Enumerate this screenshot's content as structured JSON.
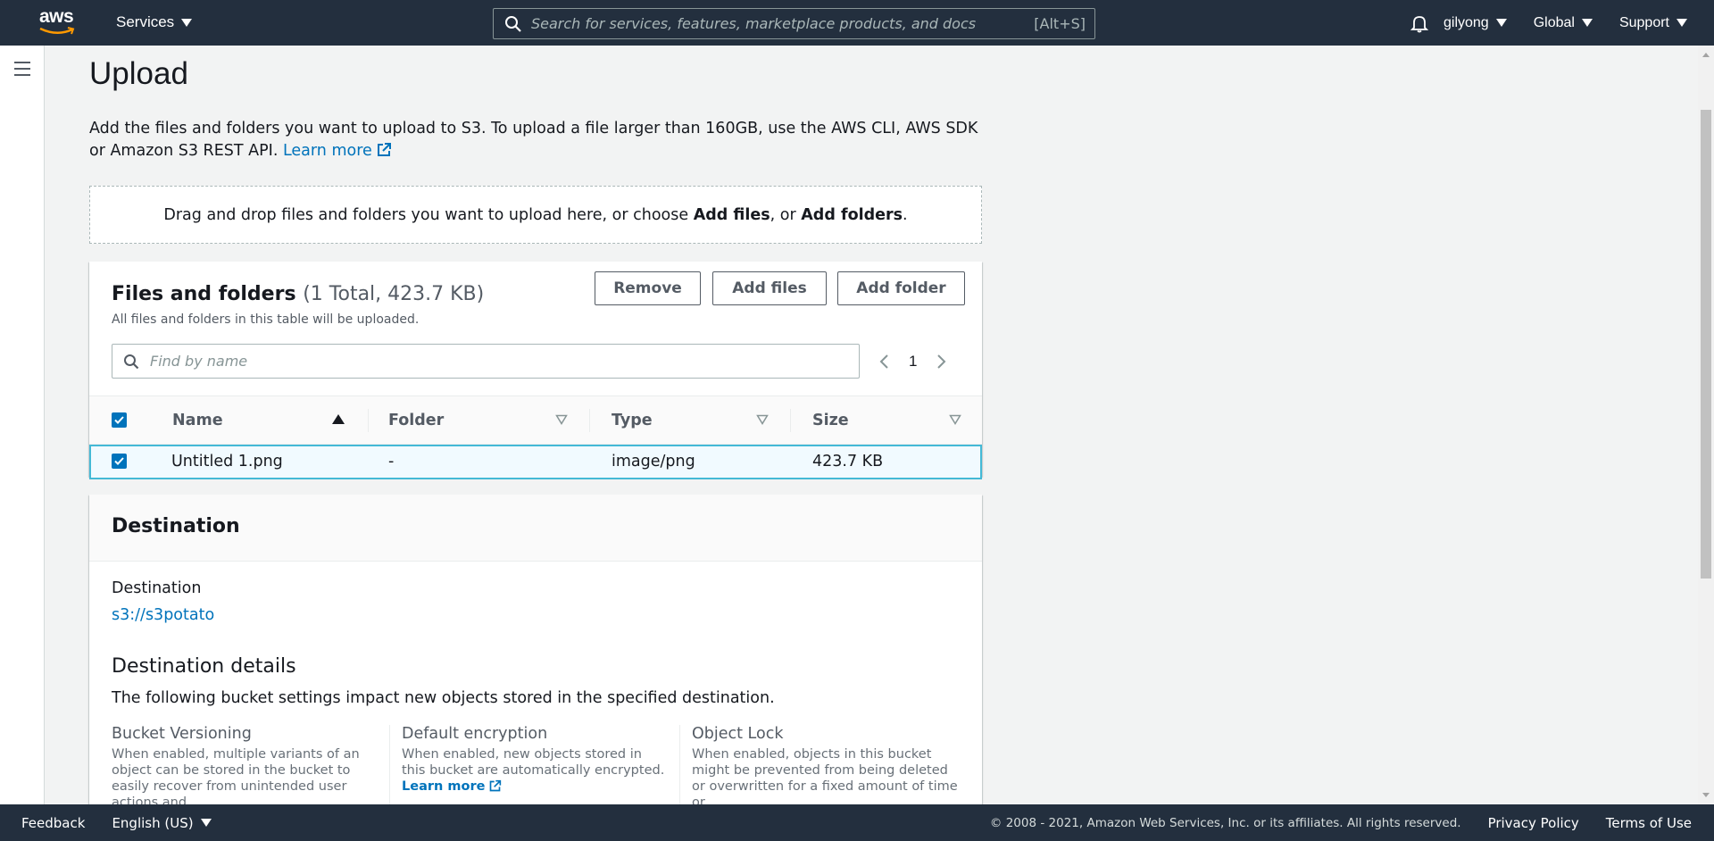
{
  "topnav": {
    "logo_text": "aws",
    "services_label": "Services",
    "search_placeholder": "Search for services, features, marketplace products, and docs",
    "search_shortcut": "[Alt+S]",
    "user_label": "gilyong",
    "region_label": "Global",
    "support_label": "Support"
  },
  "page": {
    "title": "Upload",
    "intro": "Add the files and folders you want to upload to S3. To upload a file larger than 160GB, use the AWS CLI, AWS SDK or Amazon S3 REST API.",
    "intro_link": "Learn more",
    "dropzone_prefix": "Drag and drop files and folders you want to upload here, or choose ",
    "dropzone_add_files": "Add files",
    "dropzone_mid": ", or ",
    "dropzone_add_folders": "Add folders",
    "dropzone_suffix": "."
  },
  "files_panel": {
    "title": "Files and folders",
    "count": "(1 Total, 423.7 KB)",
    "description": "All files and folders in this table will be uploaded.",
    "remove_label": "Remove",
    "add_files_label": "Add files",
    "add_folder_label": "Add folder",
    "find_placeholder": "Find by name",
    "page_number": "1",
    "columns": [
      "Name",
      "Folder",
      "Type",
      "Size"
    ],
    "rows": [
      {
        "name": "Untitled 1.png",
        "folder": "-",
        "type": "image/png",
        "size": "423.7 KB",
        "selected": true
      }
    ]
  },
  "destination": {
    "section_title": "Destination",
    "label": "Destination",
    "link": "s3://s3potato",
    "details_title": "Destination details",
    "details_desc": "The following bucket settings impact new objects stored in the specified destination.",
    "settings": [
      {
        "title": "Bucket Versioning",
        "desc": "When enabled, multiple variants of an object can be stored in the bucket to easily recover from unintended user actions and"
      },
      {
        "title": "Default encryption",
        "desc": "When enabled, new objects stored in this bucket are automatically encrypted.",
        "link": "Learn more"
      },
      {
        "title": "Object Lock",
        "desc": "When enabled, objects in this bucket might be prevented from being deleted or overwritten for a fixed amount of time or"
      }
    ]
  },
  "footer": {
    "feedback": "Feedback",
    "language": "English (US)",
    "copyright": "© 2008 - 2021, Amazon Web Services, Inc. or its affiliates. All rights reserved.",
    "privacy": "Privacy Policy",
    "terms": "Terms of Use"
  },
  "colors": {
    "nav_bg": "#232f3e",
    "link": "#0073bb",
    "selected_row_bg": "#f1faff",
    "selected_row_border": "#44b9d6"
  }
}
